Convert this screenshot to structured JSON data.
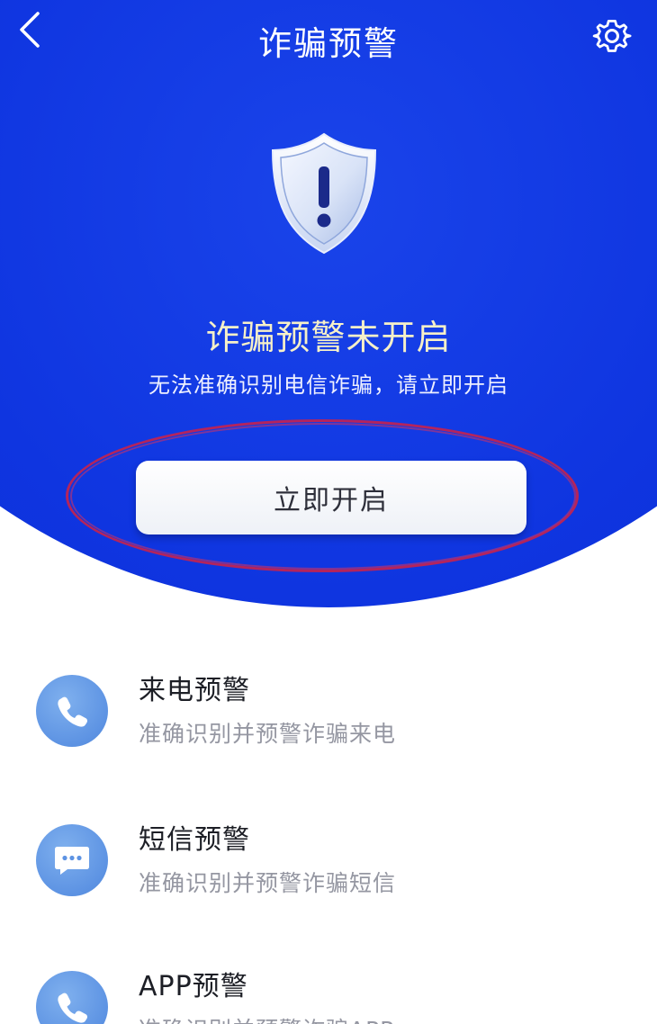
{
  "header": {
    "title": "诈骗预警",
    "back_icon": "chevron-left-icon",
    "settings_icon": "gear-icon"
  },
  "status": {
    "title": "诈骗预警未开启",
    "subtitle": "无法准确识别电信诈骗，请立即开启",
    "icon": "shield-alert-icon"
  },
  "primary_action": {
    "label": "立即开启"
  },
  "features": [
    {
      "title": "来电预警",
      "description": "准确识别并预警诈骗来电",
      "icon": "phone-icon"
    },
    {
      "title": "短信预警",
      "description": "准确识别并预警诈骗短信",
      "icon": "message-icon"
    },
    {
      "title": "APP预警",
      "description": "准确识别并预警诈骗APP",
      "icon": "phone-icon"
    }
  ],
  "colors": {
    "hero_blue": "#0f35e0",
    "icon_blue": "#5d93e3",
    "highlight_ellipse": "#c6224e",
    "status_title": "#f6f0c8"
  }
}
